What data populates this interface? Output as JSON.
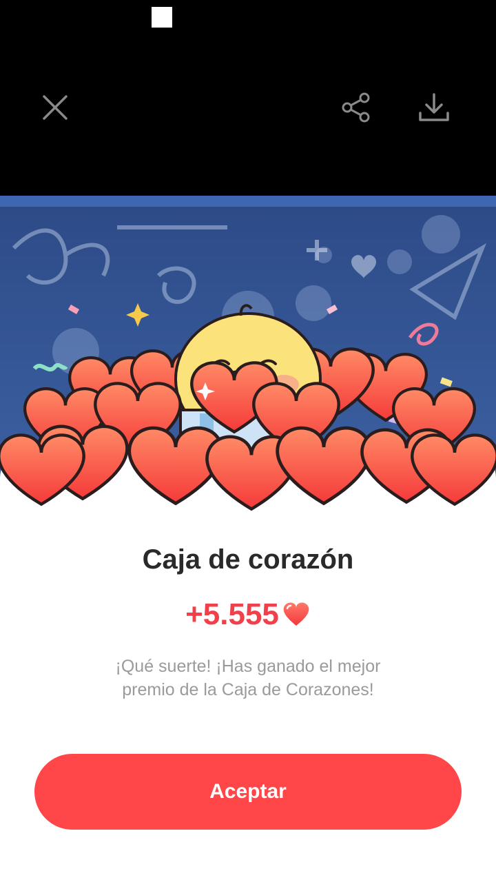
{
  "toolbar": {
    "close_icon": "close-icon",
    "share_icon": "share-icon",
    "download_icon": "download-icon"
  },
  "dialog": {
    "title": "Caja de corazón",
    "amount": "+5.555",
    "amount_icon": "heart-icon",
    "message": "¡Qué suerte! ¡Has ganado el mejor premio de la Caja de Corazones!",
    "button_label": "Aceptar"
  },
  "colors": {
    "accent": "#ff4648",
    "amount": "#f0404a",
    "photo_background": "#2d4a86"
  }
}
